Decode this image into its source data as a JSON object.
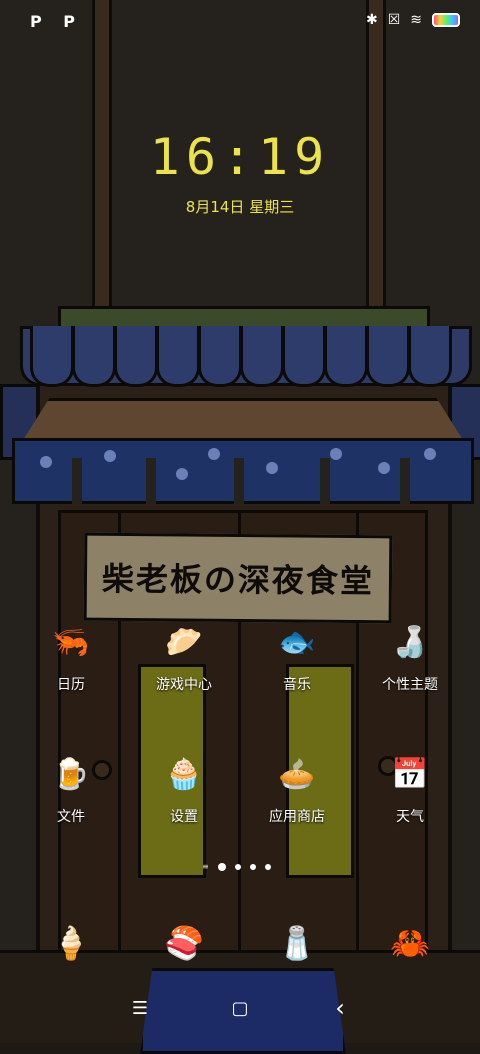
{
  "status_bar": {
    "left_text": "P P",
    "icons": [
      "bluetooth-icon",
      "sim-icon",
      "wifi-icon",
      "battery-icon"
    ]
  },
  "lock": {
    "time": "16:19",
    "date": "8月14日 星期三"
  },
  "sign_text": "柴老板の深夜食堂",
  "apps": [
    {
      "label": "日历",
      "icon": "shrimp-icon",
      "glyph": "🦐"
    },
    {
      "label": "游戏中心",
      "icon": "dumpling-icon",
      "glyph": "🥟"
    },
    {
      "label": "音乐",
      "icon": "fish-icon",
      "glyph": "🐟"
    },
    {
      "label": "个性主题",
      "icon": "bottle-icon",
      "glyph": "🍶"
    },
    {
      "label": "文件",
      "icon": "beer-mug-icon",
      "glyph": "🍺"
    },
    {
      "label": "设置",
      "icon": "muffin-icon",
      "glyph": "🧁"
    },
    {
      "label": "应用商店",
      "icon": "pie-icon",
      "glyph": "🥧"
    },
    {
      "label": "天气",
      "icon": "calendar-tile-icon",
      "glyph": "📅"
    }
  ],
  "dock": [
    {
      "icon": "ice-cream-icon",
      "glyph": "🍦"
    },
    {
      "icon": "sushi-icon",
      "glyph": "🍣"
    },
    {
      "icon": "sauce-bottle-icon",
      "glyph": "🧂"
    },
    {
      "icon": "crab-icon",
      "glyph": "🦀"
    }
  ],
  "page_indicator": {
    "pages": 4,
    "current": 1
  },
  "nav": {
    "menu": "☰",
    "home": "▢",
    "back": "‹"
  }
}
